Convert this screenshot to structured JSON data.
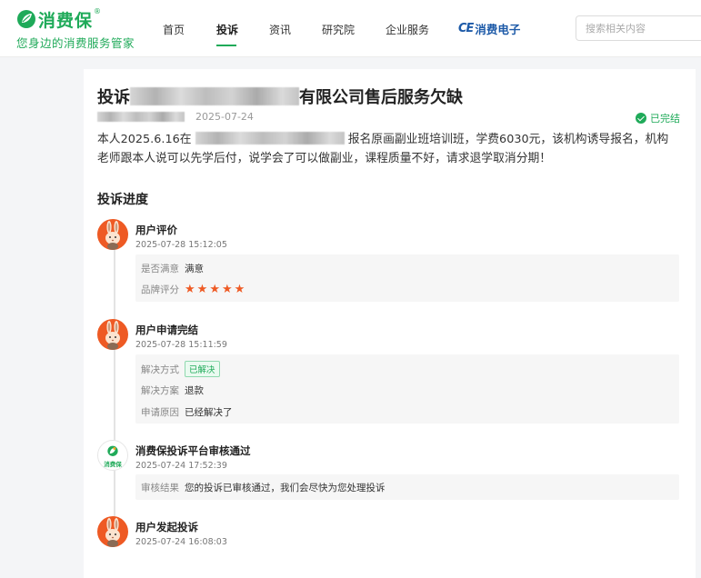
{
  "header": {
    "logo_text": "消费保",
    "logo_reg": "®",
    "slogan": "您身边的消费服务管家",
    "nav": [
      {
        "label": "首页",
        "active": false
      },
      {
        "label": "投诉",
        "active": true
      },
      {
        "label": "资讯",
        "active": false
      },
      {
        "label": "研究院",
        "active": false
      },
      {
        "label": "企业服务",
        "active": false
      }
    ],
    "ce_mark": "CE",
    "ce_label": "消费电子",
    "search_placeholder": "搜索相关内容",
    "accent_color": "#1faa59"
  },
  "complaint": {
    "title_prefix": "投诉",
    "title_suffix": "有限公司售后服务欠缺",
    "date": "2025-07-24",
    "status": "已完结",
    "desc_prefix": "本人2025.6.16在",
    "desc_suffix": "报名原画副业班培训班，学费6030元，该机构诱导报名，机构老师跟本人说可以先学后付，说学会了可以做副业，课程质量不好，请求退学取消分期！"
  },
  "progress": {
    "section_title": "投诉进度",
    "items": [
      {
        "title": "用户评价",
        "time": "2025-07-28 15:12:05",
        "avatar": "rabbit-avatar",
        "rows": [
          {
            "label": "是否满意",
            "value": "满意"
          },
          {
            "label": "品牌评分",
            "stars": 5
          }
        ]
      },
      {
        "title": "用户申请完结",
        "time": "2025-07-28 15:11:59",
        "avatar": "rabbit-avatar",
        "rows": [
          {
            "label": "解决方式",
            "tag": "已解决"
          },
          {
            "label": "解决方案",
            "value": "退款"
          },
          {
            "label": "申请原因",
            "value": "已经解决了"
          }
        ]
      },
      {
        "title": "消费保投诉平台审核通过",
        "time": "2025-07-24 17:52:39",
        "avatar": "xfb-logo",
        "avatar_text": "消费保",
        "rows": [
          {
            "label": "审核结果",
            "value": "您的投诉已审核通过，我们会尽快为您处理投诉"
          }
        ]
      },
      {
        "title": "用户发起投诉",
        "time": "2025-07-24 16:08:03",
        "avatar": "rabbit-avatar",
        "rows": []
      }
    ]
  }
}
